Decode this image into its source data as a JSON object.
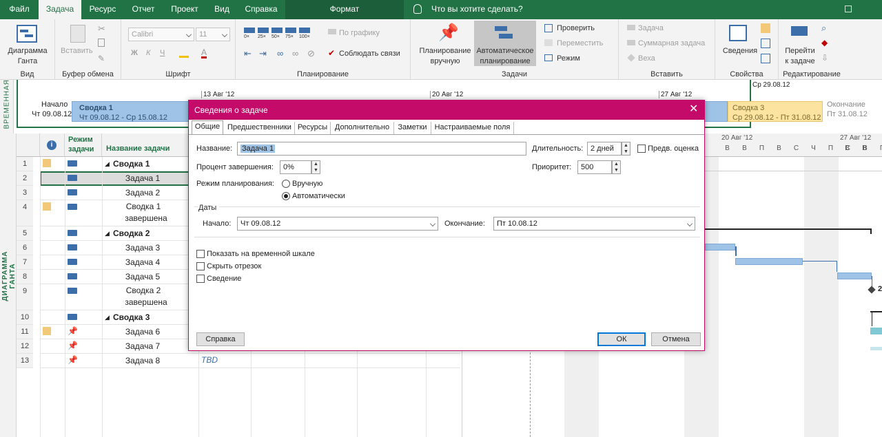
{
  "menubar": {
    "tabs": [
      "Файл",
      "Задача",
      "Ресурс",
      "Отчет",
      "Проект",
      "Вид",
      "Справка"
    ],
    "active": "Задача",
    "format": "Формат",
    "tell_me": "Что вы хотите сделать?"
  },
  "ribbon": {
    "view": {
      "gantt": "Диаграмма",
      "gantt2": "Ганта",
      "label": "Вид"
    },
    "clipboard": {
      "paste": "Вставить",
      "label": "Буфер обмена"
    },
    "font": {
      "family": "Calibri",
      "size": "11",
      "bold": "Ж",
      "italic": "К",
      "underline": "Ч",
      "label": "Шрифт"
    },
    "schedule": {
      "pcts": [
        "0×",
        "25×",
        "50×",
        "75×",
        "100×"
      ],
      "by_schedule": "По графику",
      "respect_links": "Соблюдать связи",
      "label": "Планирование"
    },
    "tasks": {
      "manual1": "Планирование",
      "manual2": "вручную",
      "auto1": "Автоматическое",
      "auto2": "планирование",
      "inspect": "Проверить",
      "move": "Переместить",
      "mode": "Режим",
      "label": "Задачи"
    },
    "insert": {
      "task": "Задача",
      "summary": "Суммарная задача",
      "milestone": "Веха",
      "label": "Вставить"
    },
    "properties": {
      "info": "Сведения",
      "label": "Свойства"
    },
    "editing": {
      "goto1": "Перейти",
      "goto2": "к задаче",
      "label": "Редактирование"
    }
  },
  "timeline": {
    "side_label": "ВРЕМЕННАЯ",
    "start_label": "Начало",
    "start_date": "Чт 09.08.12",
    "end_label": "Окончание",
    "end_date": "Пт 31.08.12",
    "dates": [
      "13 Авг '12",
      "20 Авг '12",
      "27 Авг '12"
    ],
    "top_right": "Ср 29.08.12",
    "summary1": {
      "name": "Сводка 1",
      "dates": "Чт 09.08.12 - Ср 15.08.12"
    },
    "summary3": {
      "name": "Сводка 3",
      "dates": "Ср 29.08.12 - Пт 31.08.12"
    }
  },
  "grid": {
    "side_label": "ДИАГРАММА ГАНТА",
    "col_mode1": "Режим",
    "col_mode2": "задачи",
    "col_name": "Название задачи",
    "rows": [
      {
        "n": "1",
        "name": "Сводка 1",
        "summary": true
      },
      {
        "n": "2",
        "name": "Задача 1"
      },
      {
        "n": "3",
        "name": "Задача 2"
      },
      {
        "n": "4",
        "name": "Сводка 1 завершена",
        "name2": "завершена",
        "name1": "Сводка 1"
      },
      {
        "n": "5",
        "name": "Сводка 2",
        "summary": true
      },
      {
        "n": "6",
        "name": "Задача 3"
      },
      {
        "n": "7",
        "name": "Задача 4"
      },
      {
        "n": "8",
        "name": "Задача 5"
      },
      {
        "n": "9",
        "name1": "Сводка 2",
        "name2": "завершена"
      },
      {
        "n": "10",
        "name": "Сводка 3",
        "summary": true
      },
      {
        "n": "11",
        "name": "Задача 6"
      },
      {
        "n": "12",
        "name": "Задача 7"
      },
      {
        "n": "13",
        "name": "Задача 8",
        "tbd": "TBD"
      }
    ]
  },
  "gantt": {
    "week": "20 Авг '12",
    "week2": "27 Авг '12",
    "days": [
      "В",
      "В",
      "П",
      "В",
      "С",
      "Ч",
      "П",
      "С",
      "В",
      "П"
    ],
    "days2": [
      "В",
      "В"
    ],
    "milestone_label": "2"
  },
  "dialog": {
    "title": "Сведения о задаче",
    "tabs": [
      "Общие",
      "Предшественники",
      "Ресурсы",
      "Дополнительно",
      "Заметки",
      "Настраиваемые поля"
    ],
    "name_label": "Название:",
    "name_value": "Задача 1",
    "duration_label": "Длительность:",
    "duration_value": "2 дней",
    "estimate_label": "Предв. оценка",
    "percent_label": "Процент завершения:",
    "percent_value": "0%",
    "priority_label": "Приоритет:",
    "priority_value": "500",
    "mode_label": "Режим планирования:",
    "manual": "Вручную",
    "auto": "Автоматически",
    "dates_label": "Даты",
    "start_label": "Начало:",
    "start_value": "Чт 09.08.12",
    "finish_label": "Окончание:",
    "finish_value": "Пт 10.08.12",
    "show_timeline": "Показать на временной шкале",
    "hide_bar": "Скрыть отрезок",
    "rollup": "Сведение",
    "help": "Справка",
    "ok": "ОК",
    "cancel": "Отмена"
  }
}
